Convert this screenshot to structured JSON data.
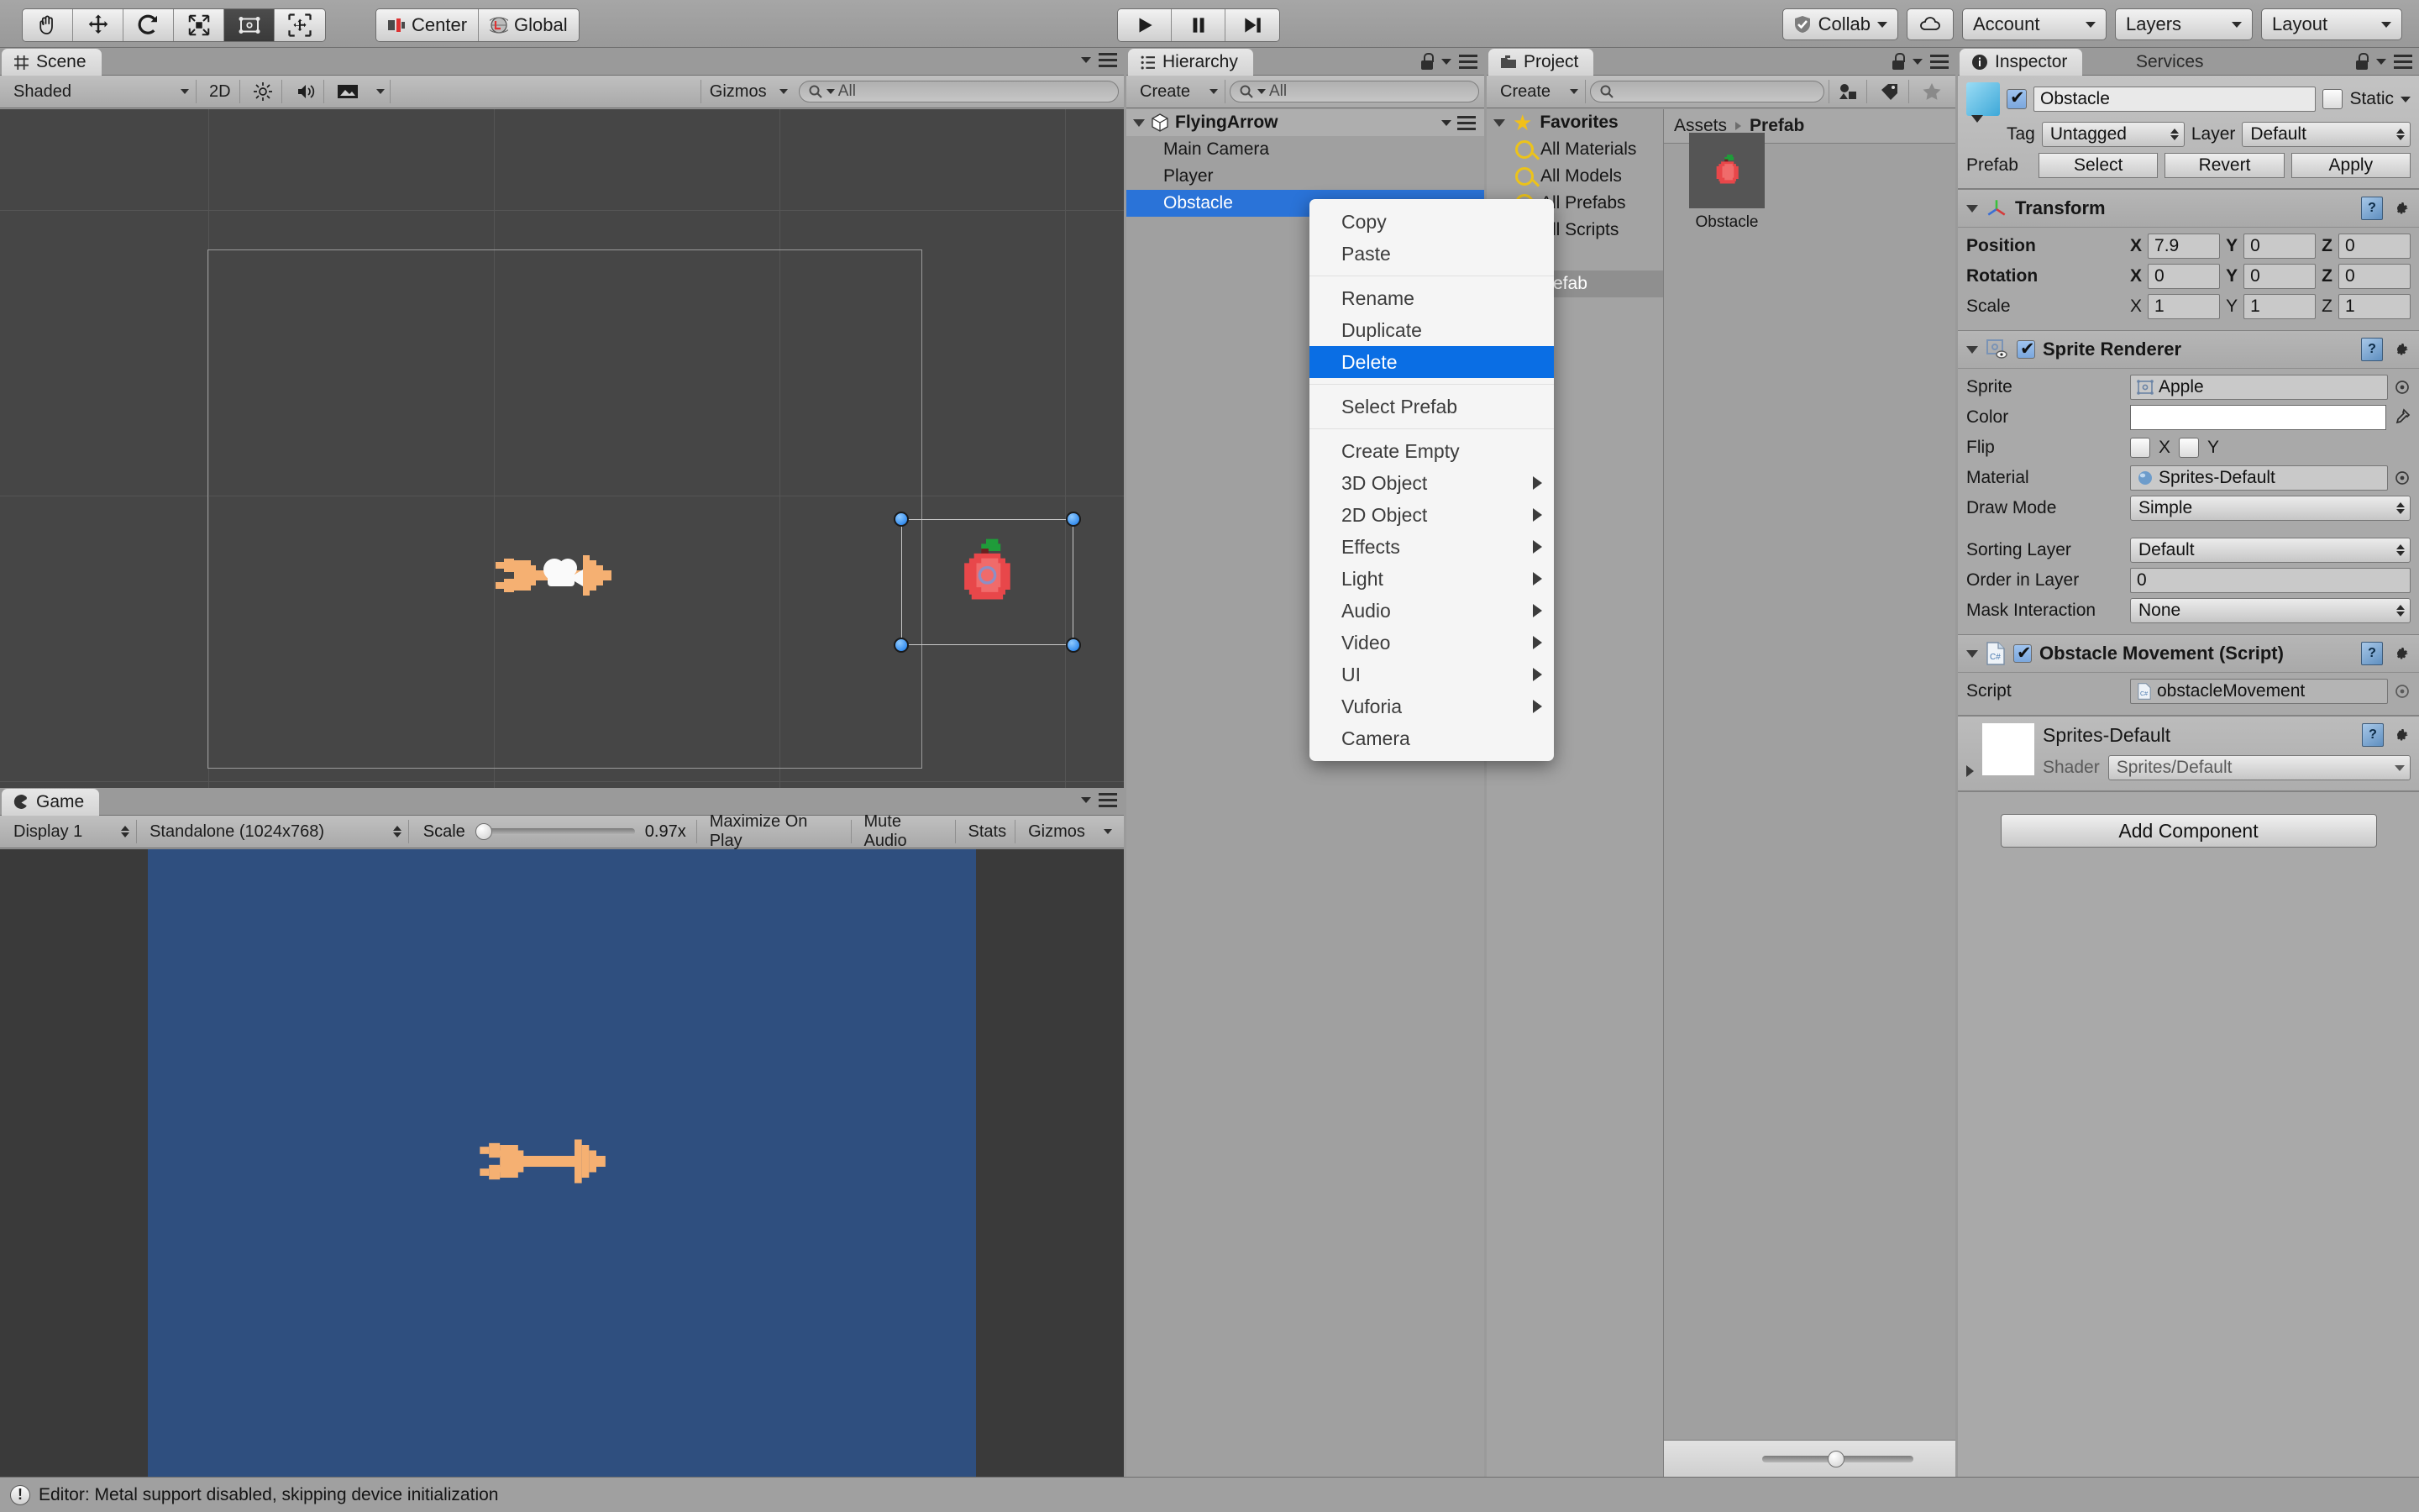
{
  "toolbar": {
    "transform_tools": [
      {
        "name": "hand-tool",
        "active": false
      },
      {
        "name": "move-tool",
        "active": false
      },
      {
        "name": "rotate-tool",
        "active": false
      },
      {
        "name": "scale-tool",
        "active": false
      },
      {
        "name": "rect-tool",
        "active": true
      },
      {
        "name": "transform-tool",
        "active": false
      }
    ],
    "pivot_label": "Center",
    "space_label": "Global",
    "play_label": "play",
    "pause_label": "pause",
    "step_label": "step",
    "collab_label": "Collab",
    "cloud_label": "cloud",
    "account_label": "Account",
    "layers_label": "Layers",
    "layout_label": "Layout"
  },
  "scene": {
    "tab_title": "Scene",
    "shading_mode": "Shaded",
    "mode_2d": "2D",
    "gizmos_label": "Gizmos",
    "search_placeholder": "All"
  },
  "game": {
    "tab_title": "Game",
    "display": "Display 1",
    "resolution": "Standalone (1024x768)",
    "scale_label": "Scale",
    "scale_value": "0.97x",
    "maximize_label": "Maximize On Play",
    "mute_label": "Mute Audio",
    "stats_label": "Stats",
    "gizmos_label": "Gizmos"
  },
  "hierarchy": {
    "tab_title": "Hierarchy",
    "create_label": "Create",
    "search_placeholder": "All",
    "scene_name": "FlyingArrow",
    "items": [
      {
        "label": "Main Camera",
        "selected": false
      },
      {
        "label": "Player",
        "selected": false
      },
      {
        "label": "Obstacle",
        "selected": true
      }
    ]
  },
  "project": {
    "tab_title": "Project",
    "create_label": "Create",
    "search_placeholder": "",
    "favorites_label": "Favorites",
    "favorites": [
      "All Materials",
      "All Models",
      "All Prefabs",
      "All Scripts"
    ],
    "assets_label": "Assets",
    "folders": [
      {
        "label": "Prefab",
        "selected": true
      }
    ],
    "breadcrumb": [
      "Assets",
      "Prefab"
    ],
    "assets": [
      {
        "label": "Obstacle",
        "icon": "apple-sprite"
      }
    ]
  },
  "inspector": {
    "tab_title": "Inspector",
    "services_tab": "Services",
    "object_name": "Obstacle",
    "object_enabled": true,
    "static_label": "Static",
    "static_checked": false,
    "tag_label": "Tag",
    "tag_value": "Untagged",
    "layer_label": "Layer",
    "layer_value": "Default",
    "prefab_label": "Prefab",
    "prefab_buttons": [
      "Select",
      "Revert",
      "Apply"
    ],
    "transform": {
      "title": "Transform",
      "rows": [
        {
          "label": "Position",
          "x": "7.9",
          "y": "0",
          "z": "0"
        },
        {
          "label": "Rotation",
          "x": "0",
          "y": "0",
          "z": "0"
        },
        {
          "label": "Scale",
          "x": "1",
          "y": "1",
          "z": "1"
        }
      ],
      "axis_labels": [
        "X",
        "Y",
        "Z"
      ]
    },
    "sprite_renderer": {
      "title": "Sprite Renderer",
      "enabled": true,
      "sprite_label": "Sprite",
      "sprite_value": "Apple",
      "color_label": "Color",
      "color_value": "#ffffff",
      "flip_label": "Flip",
      "flip_x_label": "X",
      "flip_y_label": "Y",
      "flip_x": false,
      "flip_y": false,
      "material_label": "Material",
      "material_value": "Sprites-Default",
      "draw_mode_label": "Draw Mode",
      "draw_mode_value": "Simple",
      "sorting_layer_label": "Sorting Layer",
      "sorting_layer_value": "Default",
      "order_label": "Order in Layer",
      "order_value": "0",
      "mask_label": "Mask Interaction",
      "mask_value": "None"
    },
    "script_component": {
      "title": "Obstacle Movement (Script)",
      "enabled": true,
      "script_label": "Script",
      "script_value": "obstacleMovement"
    },
    "material": {
      "title": "Sprites-Default",
      "shader_label": "Shader",
      "shader_value": "Sprites/Default"
    },
    "add_component_label": "Add Component"
  },
  "context_menu": {
    "items": [
      {
        "label": "Copy",
        "submenu": false,
        "selected": false
      },
      {
        "label": "Paste",
        "submenu": false,
        "selected": false
      },
      {
        "separator": true
      },
      {
        "label": "Rename",
        "submenu": false,
        "selected": false
      },
      {
        "label": "Duplicate",
        "submenu": false,
        "selected": false
      },
      {
        "label": "Delete",
        "submenu": false,
        "selected": true
      },
      {
        "separator": true
      },
      {
        "label": "Select Prefab",
        "submenu": false,
        "selected": false
      },
      {
        "separator": true
      },
      {
        "label": "Create Empty",
        "submenu": false,
        "selected": false
      },
      {
        "label": "3D Object",
        "submenu": true,
        "selected": false
      },
      {
        "label": "2D Object",
        "submenu": true,
        "selected": false
      },
      {
        "label": "Effects",
        "submenu": true,
        "selected": false
      },
      {
        "label": "Light",
        "submenu": true,
        "selected": false
      },
      {
        "label": "Audio",
        "submenu": true,
        "selected": false
      },
      {
        "label": "Video",
        "submenu": true,
        "selected": false
      },
      {
        "label": "UI",
        "submenu": true,
        "selected": false
      },
      {
        "label": "Vuforia",
        "submenu": true,
        "selected": false
      },
      {
        "label": "Camera",
        "submenu": false,
        "selected": false
      }
    ]
  },
  "status_bar": {
    "message": "Editor: Metal support disabled, skipping device initialization"
  },
  "colors": {
    "selection_blue": "#2a73d8",
    "menu_highlight": "#0a6ee4",
    "game_bg": "#2f4f7f",
    "scene_bg": "#464646",
    "arrow_orange": "#f5b072",
    "apple_red": "#e8474a"
  }
}
